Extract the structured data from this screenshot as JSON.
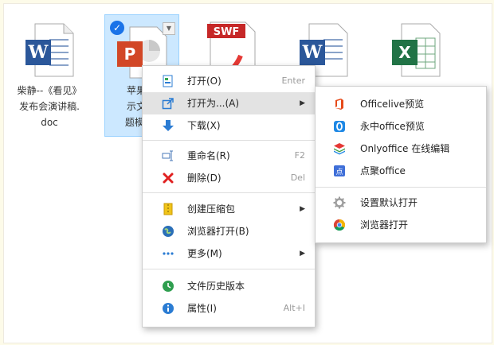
{
  "files": [
    {
      "label_lines": [
        "柴静--《看见》",
        "发布会演讲稿.",
        "doc"
      ],
      "type": "word"
    },
    {
      "label_lines": [
        "苹果发",
        "示文稿",
        "题模板-"
      ],
      "type": "powerpoint"
    },
    {
      "badge": "SWF",
      "type": "swf"
    },
    {
      "type": "word"
    },
    {
      "type": "excel"
    }
  ],
  "context_menu": {
    "items": [
      {
        "label": "打开(O)",
        "shortcut": "Enter",
        "icon": "open-icon"
      },
      {
        "label": "打开为...(A)",
        "submenu": true,
        "icon": "open-as-icon",
        "highlighted": true
      },
      {
        "label": "下载(X)",
        "icon": "download-icon"
      },
      {
        "label": "重命名(R)",
        "shortcut": "F2",
        "icon": "rename-icon"
      },
      {
        "label": "删除(D)",
        "shortcut": "Del",
        "icon": "delete-icon"
      },
      {
        "label": "创建压缩包",
        "submenu": true,
        "icon": "zip-icon"
      },
      {
        "label": "浏览器打开(B)",
        "icon": "browser-globe-icon"
      },
      {
        "label": "更多(M)",
        "submenu": true,
        "icon": "more-dots-icon"
      },
      {
        "label": "文件历史版本",
        "icon": "history-icon"
      },
      {
        "label": "属性(I)",
        "shortcut": "Alt+I",
        "icon": "info-icon"
      }
    ]
  },
  "submenu": {
    "items": [
      {
        "label": "Officelive预览",
        "icon": "office-icon"
      },
      {
        "label": "永中office预览",
        "icon": "yozo-office-icon"
      },
      {
        "label": "Onlyoffice 在线编辑",
        "icon": "onlyoffice-icon"
      },
      {
        "label": "点聚office",
        "icon": "dianju-office-icon"
      },
      {
        "label": "设置默认打开",
        "icon": "settings-gear-icon"
      },
      {
        "label": "浏览器打开",
        "icon": "chrome-icon"
      }
    ]
  },
  "colors": {
    "selection": "#cce8ff",
    "word_blue": "#2b579a",
    "ppt_orange": "#d24726",
    "excel_green": "#217346",
    "delete_red": "#e02020"
  }
}
